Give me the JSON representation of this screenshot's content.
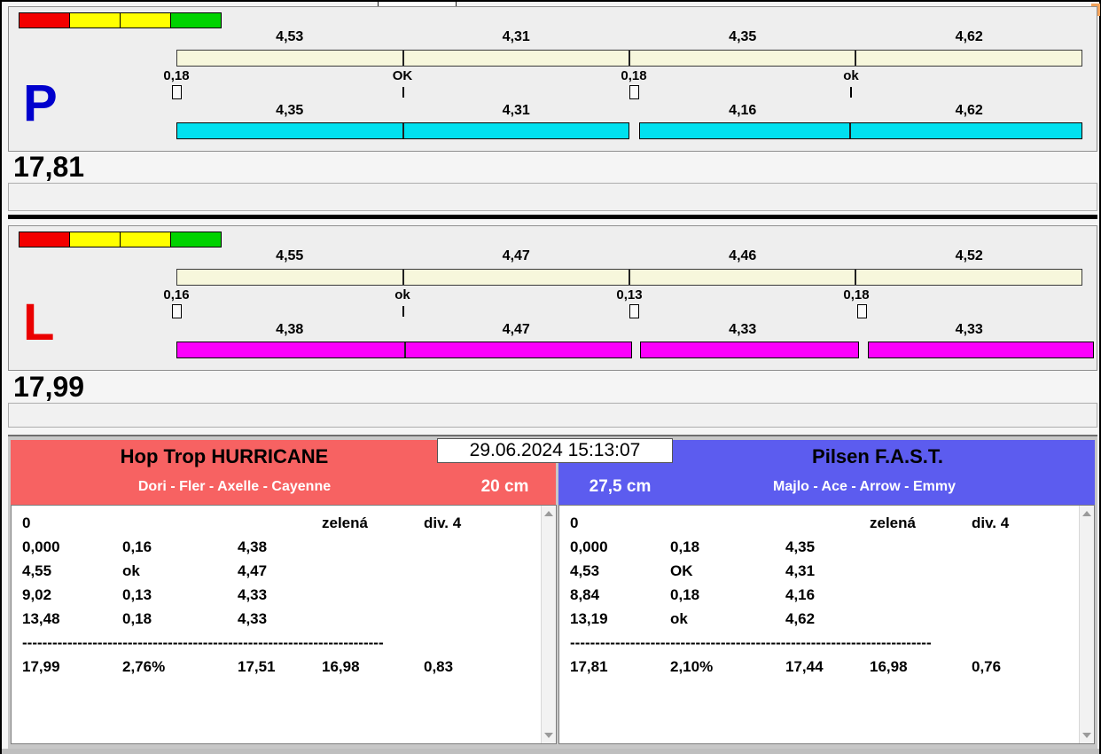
{
  "window": {
    "timestamp": "29.06.2024 15:13:07"
  },
  "colors": {
    "strip": [
      "#f30000",
      "#ffff00",
      "#ffff00",
      "#00d300"
    ],
    "gauge_track": "#f7f7dc",
    "lane_p_letter": "#0000cd",
    "lane_p_bar": "#00e0ef",
    "lane_l_letter": "#ea0000",
    "lane_l_bar": "#fb00fb",
    "team_left_header": "#f76262",
    "team_right_header": "#5c5cef"
  },
  "lanes": [
    {
      "letter": "P",
      "total": "17,81",
      "top_times": [
        "4,53",
        "4,31",
        "4,35",
        "4,62"
      ],
      "splits": [
        "0,18",
        "OK",
        "0,18",
        "ok"
      ],
      "bottom_times": [
        "4,35",
        "4,31",
        "4,16",
        "4,62"
      ]
    },
    {
      "letter": "L",
      "total": "17,99",
      "top_times": [
        "4,55",
        "4,47",
        "4,46",
        "4,52"
      ],
      "splits": [
        "0,16",
        "ok",
        "0,13",
        "0,18"
      ],
      "bottom_times": [
        "4,38",
        "4,47",
        "4,33",
        "4,33"
      ]
    }
  ],
  "teams": [
    {
      "name": "Hop Trop HURRICANE",
      "members": "Dori - Fler - Axelle - Cayenne",
      "height": "20 cm",
      "status": {
        "count": "0",
        "flag": "zelená",
        "division": "div. 4"
      },
      "rows": [
        [
          "0,000",
          "0,16",
          "4,38"
        ],
        [
          "4,55",
          "ok",
          "4,47"
        ],
        [
          "9,02",
          "0,13",
          "4,33"
        ],
        [
          "13,48",
          "0,18",
          "4,33"
        ]
      ],
      "divider": "------------------------------------------------------------------------",
      "summary": [
        "17,99",
        "2,76%",
        "17,51",
        "16,98",
        "0,83"
      ]
    },
    {
      "name": "Pilsen F.A.S.T.",
      "members": "Majlo - Ace - Arrow - Emmy",
      "height": "27,5 cm",
      "status": {
        "count": "0",
        "flag": "zelená",
        "division": "div. 4"
      },
      "rows": [
        [
          "0,000",
          "0,18",
          "4,35"
        ],
        [
          "4,53",
          "OK",
          "4,31"
        ],
        [
          "8,84",
          "0,18",
          "4,16"
        ],
        [
          "13,19",
          "ok",
          "4,62"
        ]
      ],
      "divider": "------------------------------------------------------------------------",
      "summary": [
        "17,81",
        "2,10%",
        "17,44",
        "16,98",
        "0,76"
      ]
    }
  ]
}
